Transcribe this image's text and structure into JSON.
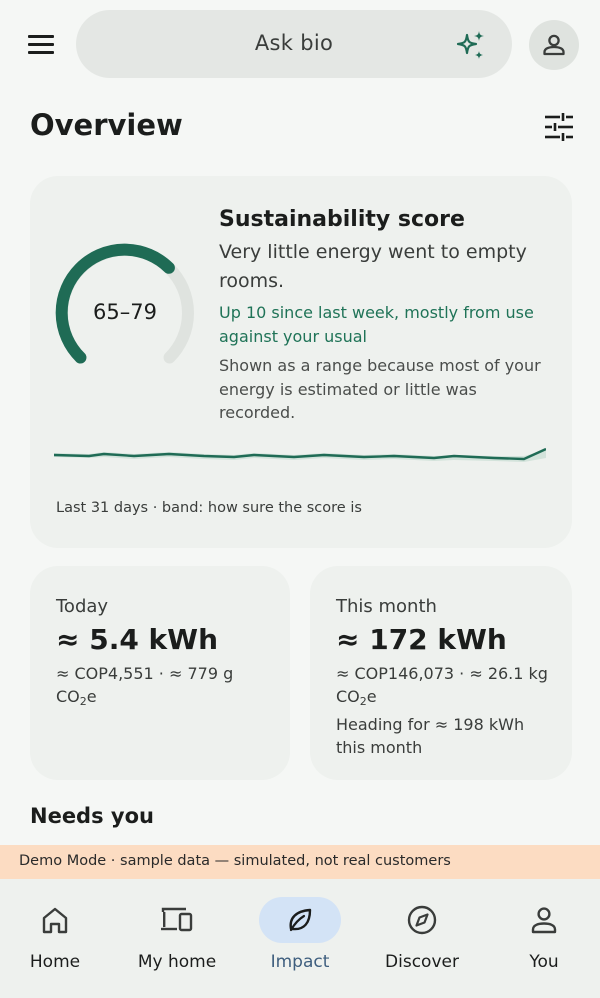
{
  "search": {
    "placeholder": "Ask bio",
    "icon": "sparkle-icon"
  },
  "header": {
    "title": "Overview"
  },
  "score_card": {
    "title": "Sustainability score",
    "range_label": "65–79",
    "range_low": 65,
    "range_high": 79,
    "description": "Very little energy went to empty rooms.",
    "change": "Up 10 since last week, mostly from use against your usual",
    "note": "Shown as a range because most of your energy is estimated or little was recorded.",
    "footer": "Last 31 days · band: how sure the score is",
    "accent_color": "#1f6b55"
  },
  "stats": {
    "today": {
      "label": "Today",
      "value": "≈ 5.4 kWh",
      "detail_prefix": "≈ COP4,551 · ≈ 779 g CO",
      "detail_sub": "2",
      "detail_suffix": "e"
    },
    "month": {
      "label": "This month",
      "value": "≈ 172 kWh",
      "detail_prefix": "≈ COP146,073 · ≈ 26.1 kg CO",
      "detail_sub": "2",
      "detail_suffix": "e",
      "forecast": "Heading for ≈ 198 kWh this month"
    }
  },
  "needs_you": {
    "title": "Needs you"
  },
  "demo_banner": {
    "text": "Demo Mode · sample data — simulated, not real customers"
  },
  "nav": {
    "items": [
      {
        "label": "Home",
        "icon": "home-icon"
      },
      {
        "label": "My home",
        "icon": "devices-icon"
      },
      {
        "label": "Impact",
        "icon": "leaf-icon",
        "active": true
      },
      {
        "label": "Discover",
        "icon": "compass-icon"
      },
      {
        "label": "You",
        "icon": "person-icon"
      }
    ],
    "active_color": "#d3e3f6"
  }
}
